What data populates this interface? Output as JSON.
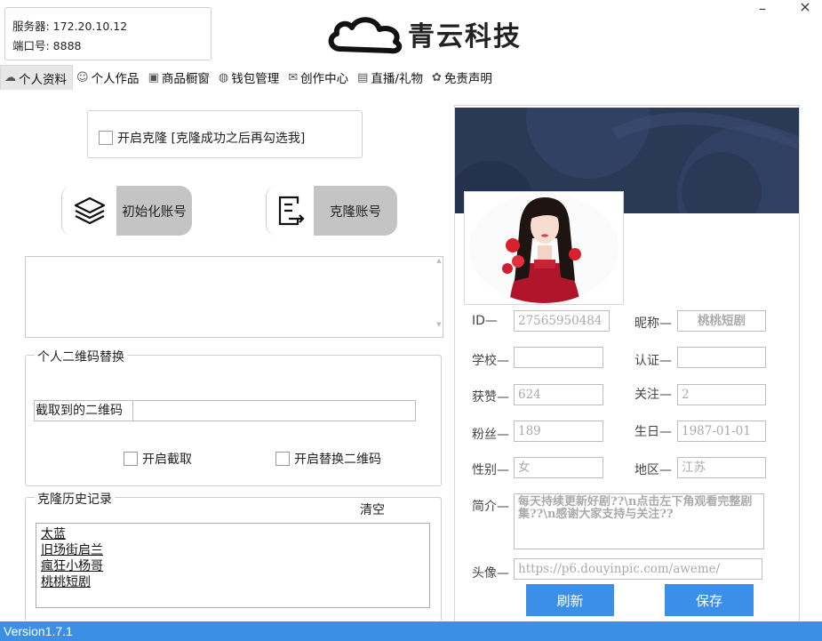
{
  "server": {
    "server_line": "服务器: 172.20.10.12",
    "port_line": "端口号: 8888"
  },
  "logo": {
    "text": "青云科技"
  },
  "window": {
    "minimize": "–",
    "close": "×"
  },
  "tabs": [
    {
      "label": "个人资料",
      "icon": "cloud-icon",
      "active": true
    },
    {
      "label": "个人作品",
      "icon": "emoji-icon",
      "active": false
    },
    {
      "label": "商品橱窗",
      "icon": "showcase-icon",
      "active": false
    },
    {
      "label": "钱包管理",
      "icon": "wallet-icon",
      "active": false
    },
    {
      "label": "创作中心",
      "icon": "mail-icon",
      "active": false
    },
    {
      "label": "直播/礼物",
      "icon": "live-icon",
      "active": false
    },
    {
      "label": "免责声明",
      "icon": "disclaimer-icon",
      "active": false
    }
  ],
  "clone_option": {
    "label": "开启克隆 [克隆成功之后再勾选我]"
  },
  "buttons": {
    "init_account": "初始化账号",
    "clone_account": "克隆账号",
    "clear": "清空",
    "refresh": "刷新",
    "save": "保存"
  },
  "qr_group": {
    "title": "个人二维码替换",
    "captured_label": "截取到的二维码",
    "captured_value": "",
    "enable_capture": "开启截取",
    "enable_replace": "开启替换二维码"
  },
  "history": {
    "title": "克隆历史记录",
    "items": [
      "太蓝",
      "旧场街启兰",
      "瘋狂小杨哥",
      "桃桃短剧"
    ]
  },
  "profile": {
    "id_label": "ID—",
    "id_value": "27565950484",
    "nickname_label": "昵称—",
    "nickname_value": "桃桃短剧",
    "school_label": "学校—",
    "school_value": "",
    "verify_label": "认证—",
    "verify_value": "",
    "likes_label": "获赞—",
    "likes_value": "624",
    "follow_label": "关注—",
    "follow_value": "2",
    "fans_label": "粉丝—",
    "fans_value": "189",
    "birthday_label": "生日—",
    "birthday_value": "1987-01-01",
    "gender_label": "性别—",
    "gender_value": "女",
    "region_label": "地区—",
    "region_value": "江苏",
    "bio_label": "简介—",
    "bio_value": "每天持续更新好剧??\\n点击左下角观看完整剧集??\\n感谢大家支持与关注??",
    "avatar_label": "头像—",
    "avatar_value": "https://p6.douyinpic.com/aweme/"
  },
  "status": {
    "version": "Version1.7.1"
  },
  "colors": {
    "accent": "#3c8fe8",
    "status_bar": "#3d8fe5",
    "banner": "#2b3a57",
    "button_gray": "#c4c4c4"
  }
}
